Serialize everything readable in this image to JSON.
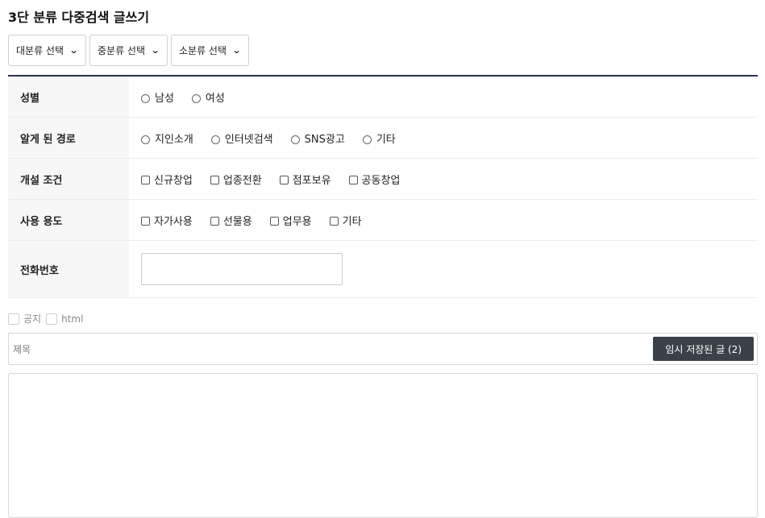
{
  "page": {
    "title": "3단 분류 다중검색 글쓰기"
  },
  "category_selects": [
    {
      "label": "대분류 선택"
    },
    {
      "label": "중분류 선택"
    },
    {
      "label": "소분류 선택"
    }
  ],
  "form": {
    "gender": {
      "label": "성별",
      "options": [
        "남성",
        "여성"
      ]
    },
    "referral": {
      "label": "알게 된 경로",
      "options": [
        "지인소개",
        "인터넷검색",
        "SNS광고",
        "기타"
      ]
    },
    "opening": {
      "label": "개설 조건",
      "options": [
        "신규창업",
        "업종전환",
        "점포보유",
        "공동창업"
      ]
    },
    "usage": {
      "label": "사용 용도",
      "options": [
        "자가사용",
        "선물용",
        "업무용",
        "기타"
      ]
    },
    "phone": {
      "label": "전화번호",
      "value": ""
    }
  },
  "post_options": {
    "notice": "공지",
    "html": "html"
  },
  "subject": {
    "placeholder": "제목",
    "temp_saved_label": "임시 저장된 글 (2)"
  },
  "editor": {
    "content": ""
  }
}
